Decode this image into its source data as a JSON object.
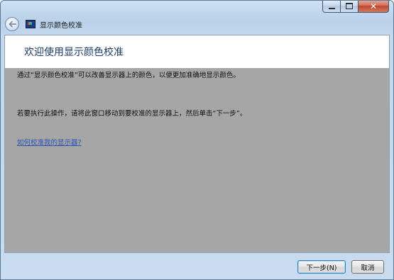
{
  "window": {
    "title": "显示颜色校准"
  },
  "caption": {
    "close_glyph": "✕"
  },
  "main": {
    "heading": "欢迎使用显示颜色校准",
    "paragraph1": "通过“显示颜色校准”可以改善显示器上的颜色，以便更加准确地显示颜色。",
    "paragraph2": "若要执行此操作，请将此窗口移动到要校准的显示器上，然后单击“下一步”。",
    "help_link": "如何校准我的显示器?"
  },
  "footer": {
    "next_label": "下一步(N)",
    "cancel_label": "取消"
  },
  "icons": {
    "back": "back-arrow-icon",
    "app": "display-color-icon",
    "minimize": "minimize-icon",
    "maximize": "maximize-icon",
    "close": "close-icon"
  },
  "colors": {
    "content_bg": "#a6a6a6",
    "header_bg": "#ffffff",
    "heading_text": "#1e3b6b",
    "link": "#2a53b3",
    "close_button": "#c0472c"
  }
}
